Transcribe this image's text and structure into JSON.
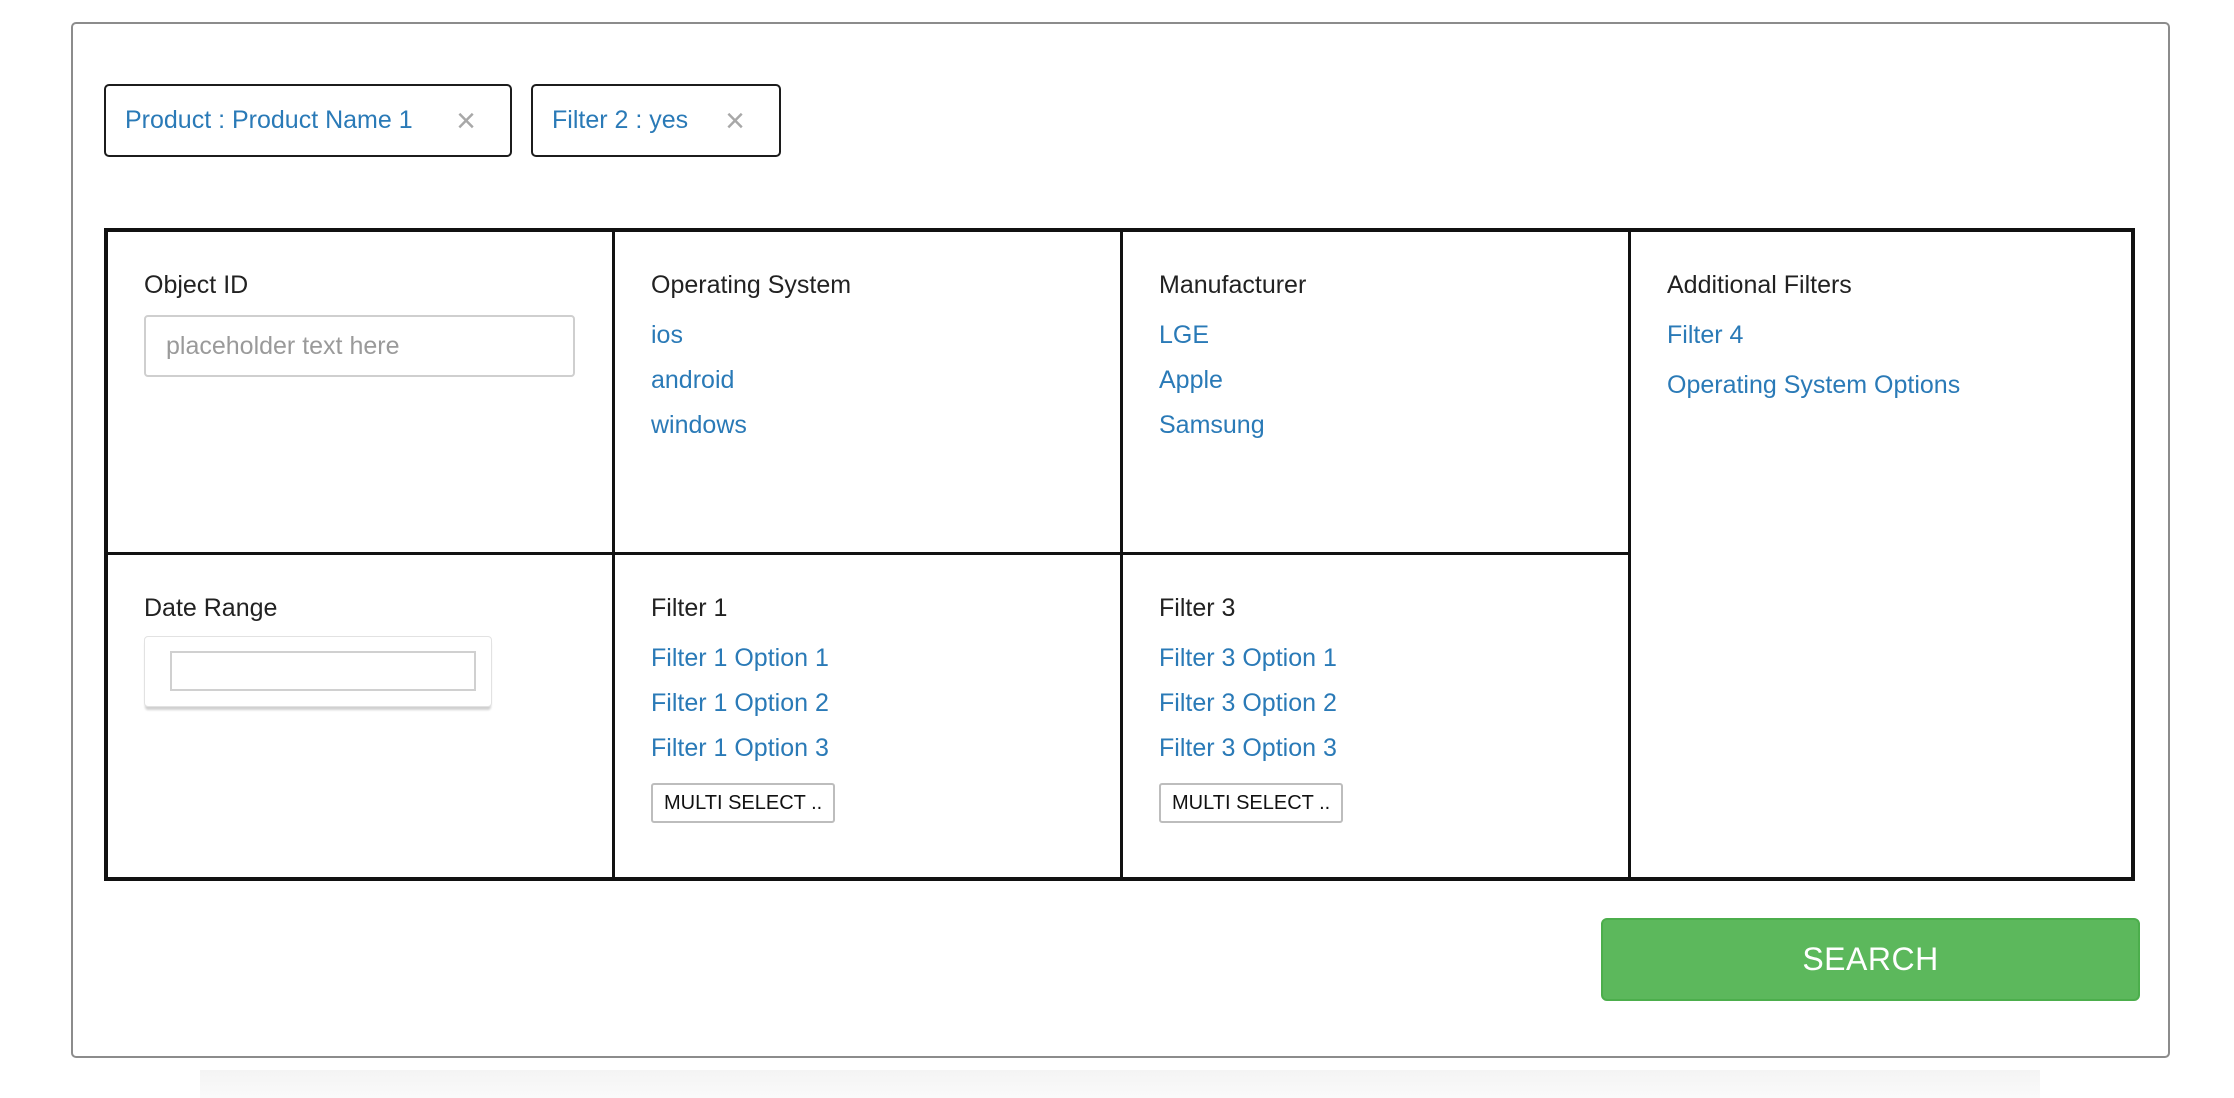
{
  "active_filters": [
    {
      "label": "Product : Product Name 1",
      "remove": "×"
    },
    {
      "label": "Filter 2 : yes",
      "remove": "×"
    }
  ],
  "object_id": {
    "title": "Object ID",
    "placeholder": "placeholder text here",
    "value": ""
  },
  "operating_system": {
    "title": "Operating System",
    "options": [
      "ios",
      "android",
      "windows"
    ]
  },
  "manufacturer": {
    "title": "Manufacturer",
    "options": [
      "LGE",
      "Apple",
      "Samsung"
    ]
  },
  "additional_filters": {
    "title": "Additional Filters",
    "options": [
      "Filter 4",
      "Operating System Options"
    ]
  },
  "date_range": {
    "title": "Date Range",
    "value": ""
  },
  "filter1": {
    "title": "Filter 1",
    "options": [
      "Filter 1 Option 1",
      "Filter 1 Option 2",
      "Filter 1 Option 3"
    ],
    "multi_select_label": "MULTI SELECT .."
  },
  "filter3": {
    "title": "Filter 3",
    "options": [
      "Filter 3 Option 1",
      "Filter 3 Option 2",
      "Filter 3 Option 3"
    ],
    "multi_select_label": "MULTI SELECT .."
  },
  "search_label": "SEARCH",
  "colors": {
    "link": "#2a7ab7",
    "search_button": "#5cb85c",
    "remove_icon": "#a8a8a8"
  }
}
